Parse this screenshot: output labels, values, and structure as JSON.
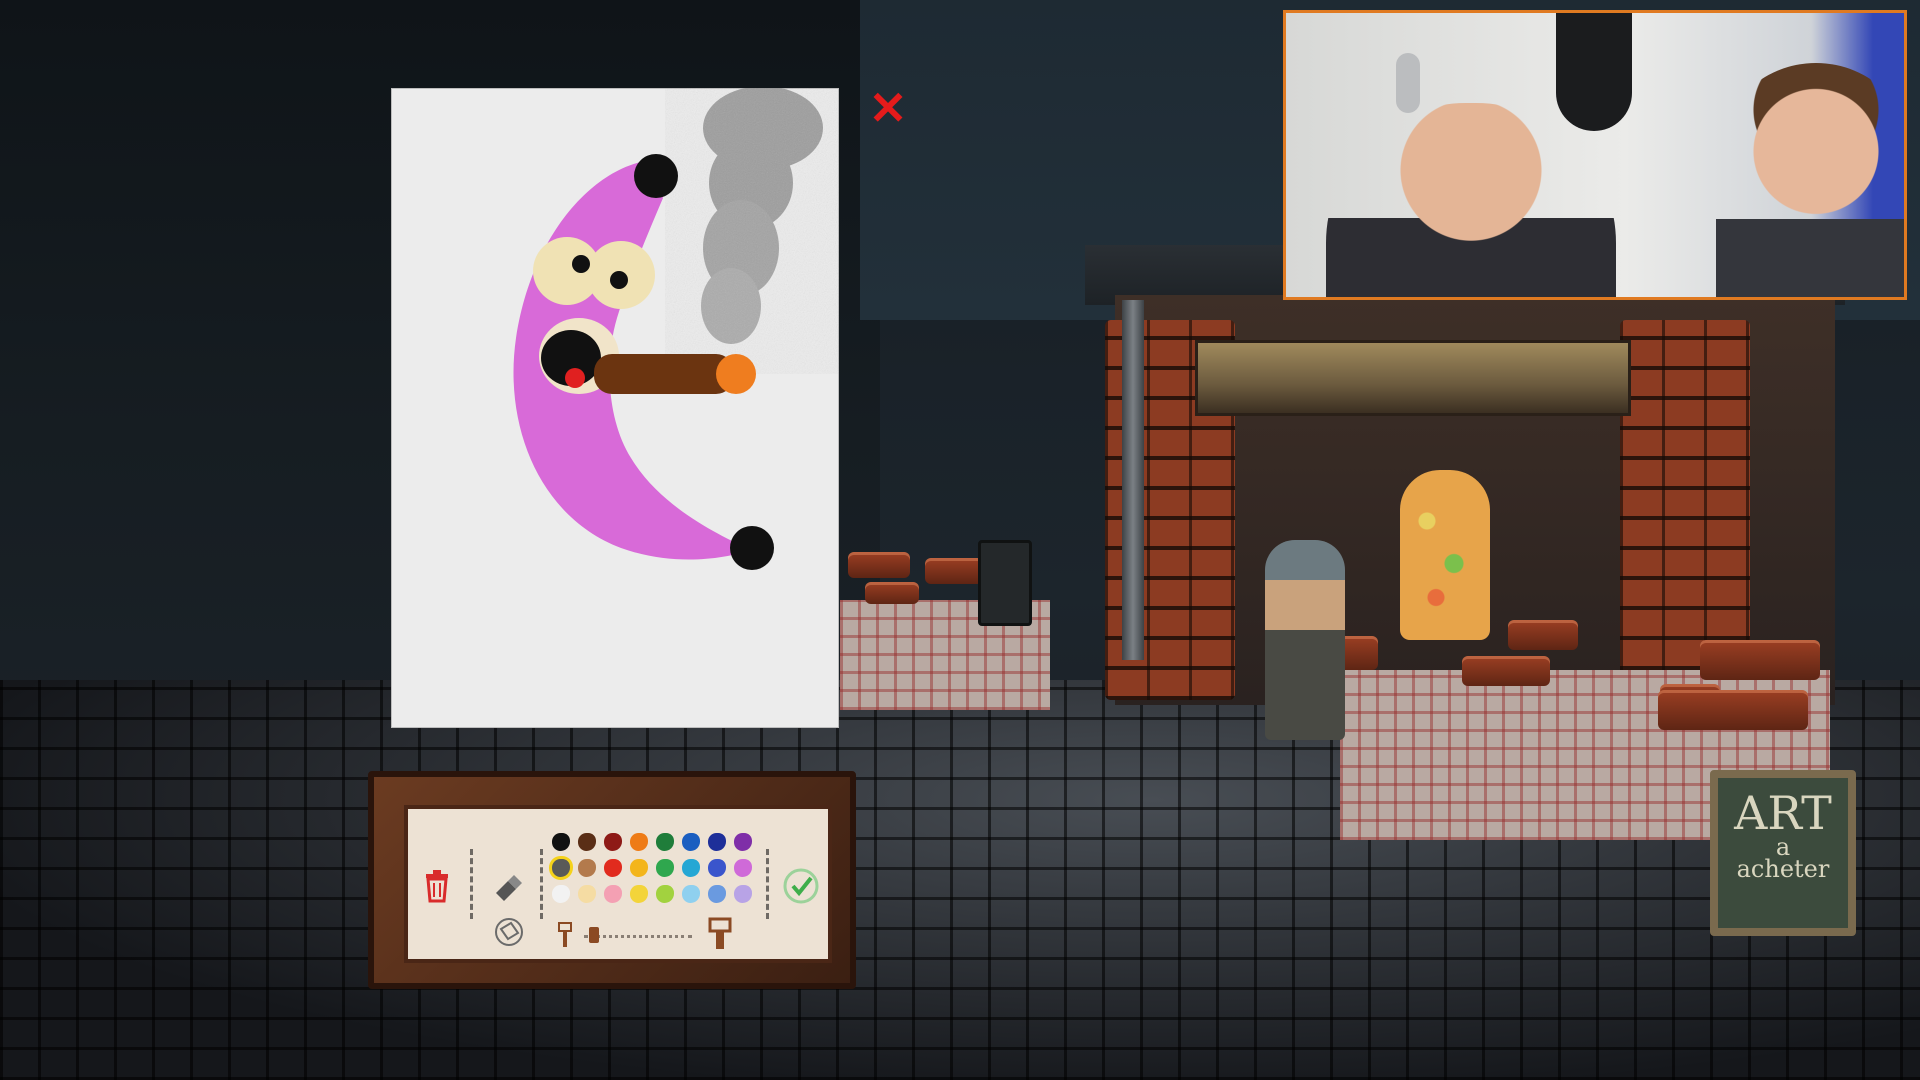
{
  "game": {
    "close_icon": "close-x-icon",
    "close_color": "#e41b1b"
  },
  "sign": {
    "title": "ART",
    "subtitle_1": "a",
    "subtitle_2": "acheter"
  },
  "toolbar": {
    "trash_icon": "trash-icon",
    "eraser_icon": "eraser-icon",
    "fill_icon": "fill-bucket-icon",
    "brush_small_icon": "brush-small-icon",
    "brush_large_icon": "brush-large-icon",
    "confirm_icon": "checkmark-confirm-icon",
    "brush_size_fraction": 0.05,
    "selected_color": "#5a5a58",
    "palette_rows": [
      [
        "#111111",
        "#5a2e16",
        "#8e1a16",
        "#ee7b16",
        "#1f7d3a",
        "#1a5ec0",
        "#1e2f99",
        "#7f2ea8"
      ],
      [
        "#5a5a58",
        "#b37a4c",
        "#e12b1e",
        "#f3b51b",
        "#2fa74e",
        "#25a7d4",
        "#3a55cc",
        "#cf6ad8"
      ],
      [
        "#f2f2f2",
        "#f5dca3",
        "#f4a0b3",
        "#f3d43a",
        "#a2d23f",
        "#8fd0ef",
        "#6a9ae0",
        "#b8a3e6"
      ]
    ]
  },
  "webcam": {
    "border_color": "#e07a21"
  }
}
